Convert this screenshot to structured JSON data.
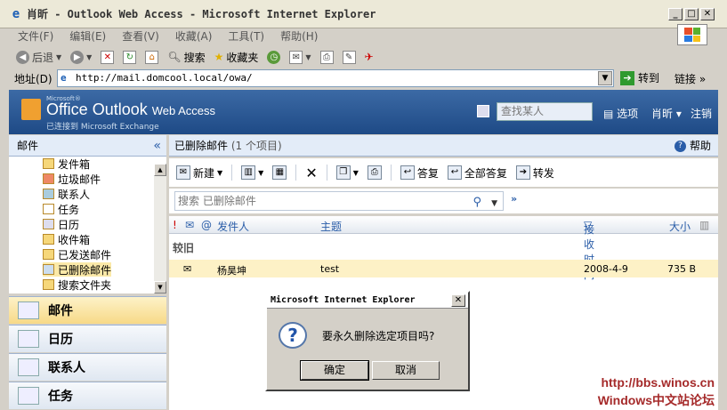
{
  "window": {
    "title": "肖昕 - Outlook Web Access - Microsoft Internet Explorer"
  },
  "menu": [
    "文件(F)",
    "编辑(E)",
    "查看(V)",
    "收藏(A)",
    "工具(T)",
    "帮助(H)"
  ],
  "toolbar": {
    "back": "后退",
    "search": "搜索",
    "favorites": "收藏夹"
  },
  "address": {
    "label": "地址(D)",
    "url": "http://mail.domcool.local/owa/",
    "go": "转到",
    "links": "链接"
  },
  "owa": {
    "ms": "Microsoft®",
    "brand": "Office Outlook",
    "brand_suffix": "Web Access",
    "sub": "已连接到 Microsoft Exchange",
    "find_placeholder": "查找某人",
    "options": "选项",
    "user": "肖昕",
    "logout": "注销"
  },
  "left": {
    "header": "邮件",
    "folders": [
      "发件箱",
      "垃圾邮件",
      "联系人",
      "任务",
      "日历",
      "收件箱",
      "已发送邮件",
      "已删除邮件",
      "搜索文件夹"
    ]
  },
  "nav": [
    "邮件",
    "日历",
    "联系人",
    "任务"
  ],
  "main": {
    "title": "已删除邮件",
    "count": "(1 个项目)",
    "help": "帮助"
  },
  "actions": {
    "new": "新建",
    "reply": "答复",
    "reply_all": "全部答复",
    "forward": "转发"
  },
  "search": {
    "placeholder": "搜索 已删除邮件"
  },
  "columns": {
    "from": "发件人",
    "subject": "主题",
    "received": "接收时间",
    "size": "大小"
  },
  "group": "较旧",
  "message": {
    "from": "杨昊坤",
    "subject": "test",
    "date": "2008-4-9",
    "size": "735 B"
  },
  "dialog": {
    "title": "Microsoft Internet Explorer",
    "message": "要永久删除选定项目吗?",
    "ok": "确定",
    "cancel": "取消"
  },
  "watermark": {
    "url": "http://bbs.winos.cn",
    "name": "Windows中文站论坛"
  }
}
